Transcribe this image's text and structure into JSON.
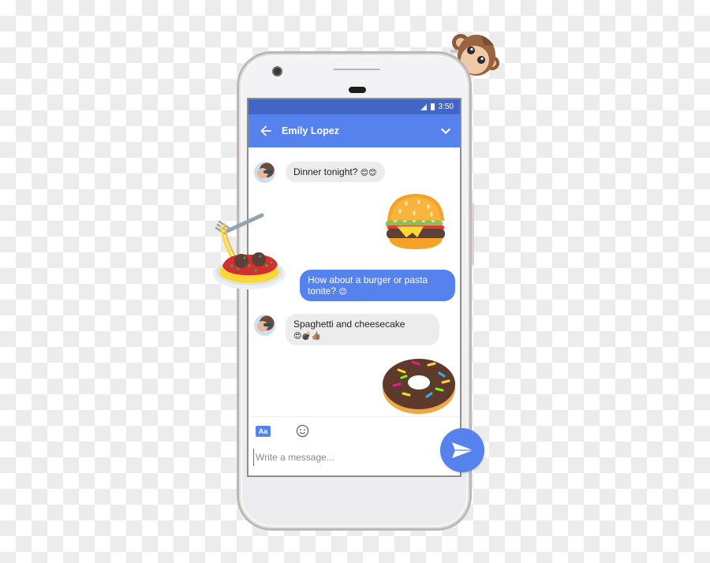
{
  "status_bar": {
    "time": "3:50",
    "icons": [
      "signal-icon",
      "battery-icon"
    ]
  },
  "app_bar": {
    "contact_name": "Emily Lopez",
    "back_icon": "arrow-left-icon",
    "menu_icon": "chevron-down-icon"
  },
  "messages": [
    {
      "from": "them",
      "type": "text",
      "text": "Dinner tonight?",
      "emoji": "😊😊"
    },
    {
      "from": "me",
      "type": "sticker",
      "sticker": "hamburger"
    },
    {
      "from": "me",
      "type": "text",
      "text": "How about a burger or pasta tonite?",
      "emoji": "😊"
    },
    {
      "from": "them",
      "type": "text",
      "text": "Spaghetti and cheesecake",
      "emoji": "😍💣👍🏽"
    },
    {
      "from": "me",
      "type": "sticker",
      "sticker": "doughnut"
    }
  ],
  "composer": {
    "format_button_label": "Aa",
    "emoji_button_icon": "smiley-icon",
    "input_placeholder": "Write a message...",
    "input_value": "",
    "send_icon": "send-icon"
  },
  "decorations": [
    "monkey-sticker",
    "spaghetti-sticker"
  ],
  "colors": {
    "accent": "#5582ed",
    "status_bar": "#4266c5",
    "incoming_bubble": "#ececec"
  }
}
